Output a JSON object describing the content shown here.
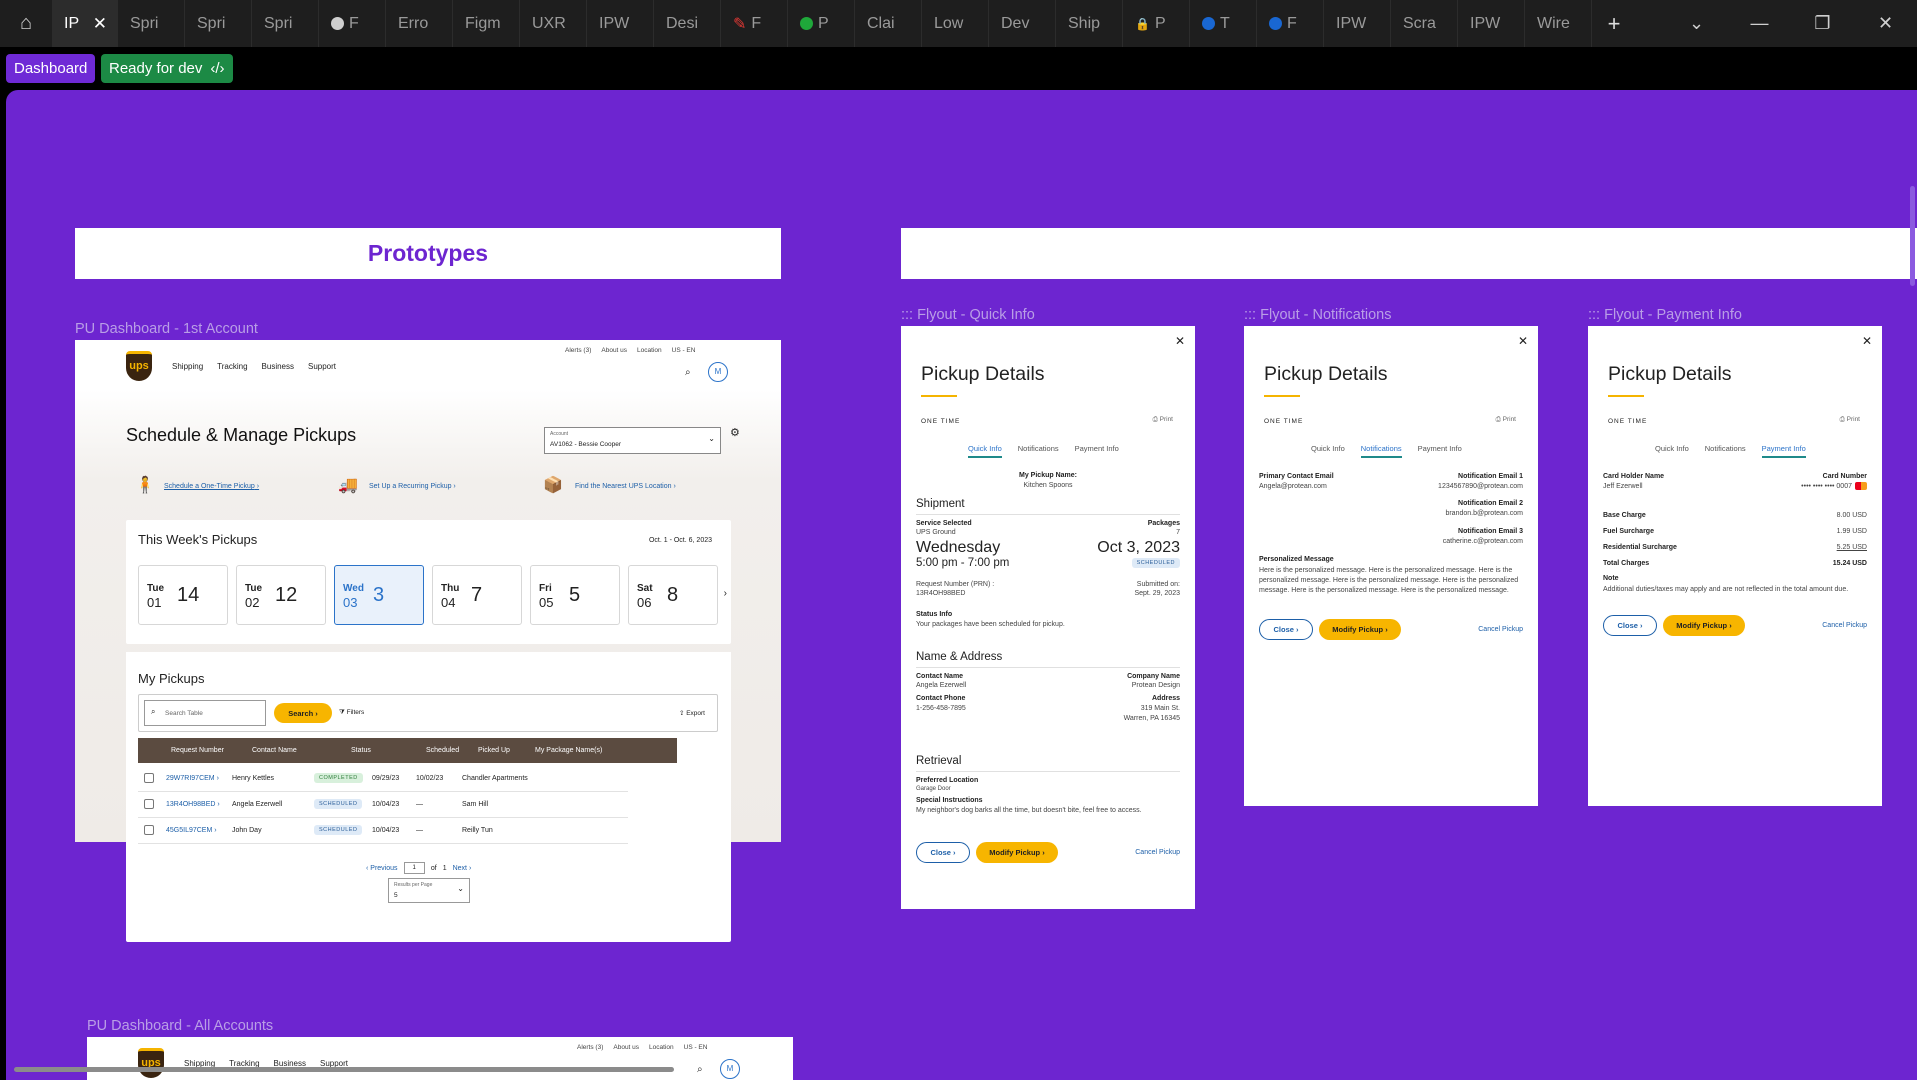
{
  "tabs": [
    {
      "label": "IP",
      "active": true
    },
    {
      "label": "Spri"
    },
    {
      "label": "Spri"
    },
    {
      "label": "Spri"
    },
    {
      "label": "F",
      "icon": "circle-grey"
    },
    {
      "label": "Erro"
    },
    {
      "label": "Figm"
    },
    {
      "label": "UXR"
    },
    {
      "label": "IPW"
    },
    {
      "label": "Desi"
    },
    {
      "label": "F",
      "icon": "pen-red"
    },
    {
      "label": "P",
      "icon": "circle-green"
    },
    {
      "label": "Clai"
    },
    {
      "label": "Low"
    },
    {
      "label": "Dev"
    },
    {
      "label": "Ship"
    },
    {
      "label": "P",
      "icon": "lock"
    },
    {
      "label": "T",
      "icon": "circle-blue"
    },
    {
      "label": "F",
      "icon": "circle-blue"
    },
    {
      "label": "IPW"
    },
    {
      "label": "Scra"
    },
    {
      "label": "IPW"
    },
    {
      "label": "Wire"
    }
  ],
  "status": {
    "dashboard": "Dashboard",
    "ready": "Ready for dev",
    "ready_icon": "code-icon"
  },
  "frames": {
    "prototypes_title": "Prototypes",
    "dash1_label": "PU Dashboard - 1st Account",
    "dash2_label": "PU Dashboard - All Accounts",
    "fly1_label": "::: Flyout - Quick Info",
    "fly2_label": "::: Flyout - Notifications",
    "fly3_label": "::: Flyout - Payment Info"
  },
  "dashboard": {
    "top_links": [
      "Alerts (3)",
      "About us",
      "Location",
      "US - EN"
    ],
    "nav": [
      "Shipping",
      "Tracking",
      "Business",
      "Support"
    ],
    "avatar": "M",
    "title": "Schedule & Manage Pickups",
    "account_label": "Account",
    "account_value": "AV1062 - Bessie Cooper",
    "quick_links": [
      "Schedule a One-Time Pickup",
      "Set Up a Recurring Pickup",
      "Find the Nearest UPS Location"
    ],
    "week_title": "This Week's Pickups",
    "week_range": "Oct. 1 - Oct. 6, 2023",
    "days": [
      {
        "name": "Tue",
        "date": "01",
        "count": "14"
      },
      {
        "name": "Tue",
        "date": "02",
        "count": "12"
      },
      {
        "name": "Wed",
        "date": "03",
        "count": "3",
        "selected": true
      },
      {
        "name": "Thu",
        "date": "04",
        "count": "7"
      },
      {
        "name": "Fri",
        "date": "05",
        "count": "5"
      },
      {
        "name": "Sat",
        "date": "06",
        "count": "8"
      }
    ],
    "my_pickups": "My Pickups",
    "search_placeholder": "Search Table",
    "search_btn": "Search",
    "filters": "Filters",
    "export": "Export",
    "columns": [
      "Request Number",
      "Contact Name",
      "Status",
      "Scheduled",
      "Picked Up",
      "My Package Name(s)"
    ],
    "rows": [
      {
        "req": "29W7RI97CEM",
        "contact": "Henry Kettles",
        "status": "COMPLETED",
        "scheduled": "09/29/23",
        "picked": "10/02/23",
        "pkg": "Chandler Apartments"
      },
      {
        "req": "13R4OH98BED",
        "contact": "Angela Ezerwell",
        "status": "SCHEDULED",
        "scheduled": "10/04/23",
        "picked": "—",
        "pkg": "Sam Hill"
      },
      {
        "req": "45G5IL97CEM",
        "contact": "John Day",
        "status": "SCHEDULED",
        "scheduled": "10/04/23",
        "picked": "—",
        "pkg": "Reilly Tun"
      }
    ],
    "prev": "Previous",
    "page": "1",
    "of": "of",
    "total_pages": "1",
    "next": "Next",
    "rpp_label": "Results per Page",
    "rpp_value": "5"
  },
  "flyout": {
    "title": "Pickup Details",
    "one_time": "ONE TIME",
    "print": "Print",
    "tabs": [
      "Quick Info",
      "Notifications",
      "Payment Info"
    ],
    "close": "Close",
    "modify": "Modify Pickup",
    "cancel": "Cancel Pickup",
    "quick": {
      "pickup_name_label": "My Pickup Name:",
      "pickup_name": "Kitchen Spoons",
      "shipment": "Shipment",
      "service_label": "Service Selected",
      "service": "UPS Ground",
      "packages_label": "Packages",
      "packages": "7",
      "day": "Wednesday",
      "date": "Oct 3, 2023",
      "time": "5:00 pm - 7:00 pm",
      "status": "SCHEDULED",
      "prn_label": "Request Number (PRN) :",
      "prn": "13R4OH98BED",
      "submitted_label": "Submitted on:",
      "submitted": "Sept. 29, 2023",
      "status_info_label": "Status Info",
      "status_info": "Your packages have been scheduled for pickup.",
      "name_address": "Name & Address",
      "contact_label": "Contact Name",
      "contact": "Angela Ezerwell",
      "company_label": "Company Name",
      "company": "Protean Design",
      "phone_label": "Contact Phone",
      "phone": "1-256-458-7895",
      "address_label": "Address",
      "address1": "319 Main St.",
      "address2": "Warren, PA 16345",
      "retrieval": "Retrieval",
      "location_label": "Preferred Location",
      "location": "Garage Door",
      "instructions_label": "Special Instructions",
      "instructions": "My neighbor's dog barks all the time, but doesn't bite, feel free to access."
    },
    "notif": {
      "primary_label": "Primary Contact Email",
      "primary": "Angela@protean.com",
      "n1_label": "Notification Email 1",
      "n1": "1234567890@protean.com",
      "n2_label": "Notification Email 2",
      "n2": "brandon.b@protean.com",
      "n3_label": "Notification Email 3",
      "n3": "catherine.c@protean.com",
      "msg_label": "Personalized Message",
      "msg": "Here is the personalized message. Here is the personalized message. Here is the personalized message. Here is the personalized message. Here is the personalized message. Here is the personalized message. Here is the personalized message."
    },
    "payment": {
      "holder_label": "Card Holder Name",
      "holder": "Jeff Ezerwell",
      "card_label": "Card Number",
      "card": "•••• •••• •••• 0007",
      "base_label": "Base Charge",
      "base": "8.00 USD",
      "fuel_label": "Fuel Surcharge",
      "fuel": "1.99 USD",
      "res_label": "Residential  Surcharge",
      "res": "5.25 USD",
      "total_label": "Total Charges",
      "total": "15.24 USD",
      "note_label": "Note",
      "note": "Additional duties/taxes may apply and are not reflected in the total amount due."
    }
  }
}
